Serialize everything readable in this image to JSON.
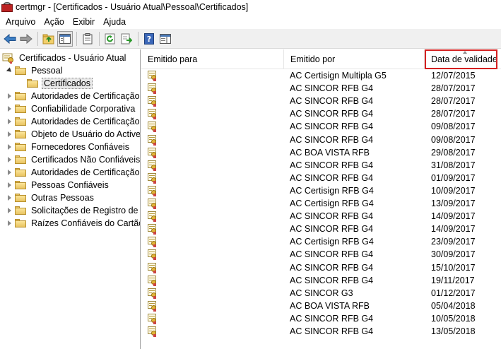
{
  "window": {
    "title": "certmgr - [Certificados - Usuário Atual\\Pessoal\\Certificados]"
  },
  "menu": {
    "items": [
      {
        "label": "Arquivo",
        "accel": "A",
        "rest": "rquivo"
      },
      {
        "label": "Ação",
        "accel": "ç",
        "rest": ""
      },
      {
        "label": "Exibir",
        "accel": "E",
        "rest": "xibir"
      },
      {
        "label": "Ajuda",
        "accel": "j",
        "rest": ""
      }
    ]
  },
  "toolbar": {
    "buttons": [
      "back-icon",
      "forward-icon",
      "up-folder-icon",
      "show-hide-tree-icon",
      "clipboard-icon",
      "refresh-icon",
      "export-list-icon",
      "help-icon",
      "properties-pane-icon"
    ]
  },
  "tree": {
    "root": "Certificados - Usuário Atual",
    "pessoal": "Pessoal",
    "certificados": "Certificados",
    "nodes": [
      "Autoridades de Certificação R",
      "Confiabilidade Corporativa",
      "Autoridades de Certificação I",
      "Objeto de Usuário do Active I",
      "Fornecedores Confiáveis",
      "Certificados Não Confiáveis",
      "Autoridades de Certificação R",
      "Pessoas Confiáveis",
      "Outras Pessoas",
      "Solicitações de Registro de Ce",
      "Raízes Confiáveis do Cartão Ir"
    ]
  },
  "list": {
    "columns": {
      "issued_to": "Emitido para",
      "issued_by": "Emitido por",
      "expiration": "Data de validade"
    },
    "highlight_color": "#d42020",
    "rows": [
      {
        "issued_to": "",
        "issued_by": "AC Certisign Multipla G5",
        "expiration": "12/07/2015"
      },
      {
        "issued_to": "",
        "issued_by": "AC SINCOR RFB G4",
        "expiration": "28/07/2017"
      },
      {
        "issued_to": "",
        "issued_by": "AC SINCOR RFB G4",
        "expiration": "28/07/2017"
      },
      {
        "issued_to": "",
        "issued_by": "AC SINCOR RFB G4",
        "expiration": "28/07/2017"
      },
      {
        "issued_to": "",
        "issued_by": "AC SINCOR RFB G4",
        "expiration": "09/08/2017"
      },
      {
        "issued_to": "",
        "issued_by": "AC SINCOR RFB G4",
        "expiration": "09/08/2017"
      },
      {
        "issued_to": "",
        "issued_by": "AC BOA VISTA RFB",
        "expiration": "29/08/2017"
      },
      {
        "issued_to": "",
        "issued_by": "AC SINCOR RFB G4",
        "expiration": "31/08/2017"
      },
      {
        "issued_to": "",
        "issued_by": "AC SINCOR RFB G4",
        "expiration": "01/09/2017"
      },
      {
        "issued_to": "",
        "issued_by": "AC Certisign RFB G4",
        "expiration": "10/09/2017"
      },
      {
        "issued_to": "",
        "issued_by": "AC Certisign RFB G4",
        "expiration": "13/09/2017"
      },
      {
        "issued_to": "",
        "issued_by": "AC SINCOR RFB G4",
        "expiration": "14/09/2017"
      },
      {
        "issued_to": "",
        "issued_by": "AC SINCOR RFB G4",
        "expiration": "14/09/2017"
      },
      {
        "issued_to": "",
        "issued_by": "AC Certisign RFB G4",
        "expiration": "23/09/2017"
      },
      {
        "issued_to": "",
        "issued_by": "AC SINCOR RFB G4",
        "expiration": "30/09/2017"
      },
      {
        "issued_to": "",
        "issued_by": "AC SINCOR RFB G4",
        "expiration": "15/10/2017"
      },
      {
        "issued_to": "",
        "issued_by": "AC SINCOR RFB G4",
        "expiration": "19/11/2017"
      },
      {
        "issued_to": "",
        "issued_by": "AC SINCOR G3",
        "expiration": "01/12/2017"
      },
      {
        "issued_to": "",
        "issued_by": "AC BOA VISTA RFB",
        "expiration": "05/04/2018"
      },
      {
        "issued_to": "",
        "issued_by": "AC SINCOR RFB G4",
        "expiration": "10/05/2018"
      },
      {
        "issued_to": "",
        "issued_by": "AC SINCOR RFB G4",
        "expiration": "13/05/2018"
      }
    ]
  }
}
